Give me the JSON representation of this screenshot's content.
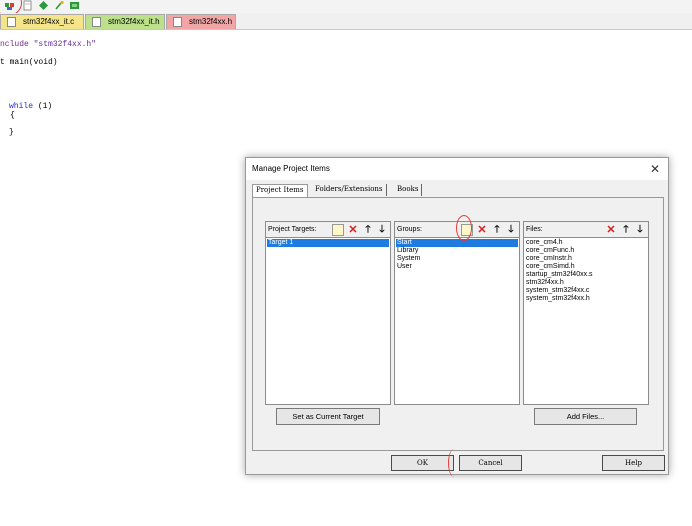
{
  "tabs": [
    {
      "label": "stm32f4xx_it.c"
    },
    {
      "label": "stm32f4xx_it.h"
    },
    {
      "label": "stm32f4xx.h"
    }
  ],
  "code": {
    "include_kw": "nclude",
    "include_file": "\"stm32f4xx.h\"",
    "main_line": "t main(void)",
    "while_kw": "while",
    "while_cond": " (1)",
    "open_brace": "{",
    "close_brace": "}"
  },
  "dialog": {
    "title": "Manage Project Items",
    "close_glyph": "✕",
    "tabs": [
      "Project Items",
      "Folders/Extensions",
      "Books"
    ],
    "targets": {
      "label": "Project Targets:",
      "items": [
        "Target 1"
      ],
      "selected": 0
    },
    "groups": {
      "label": "Groups:",
      "items": [
        "Start",
        "Library",
        "System",
        "User"
      ],
      "selected": 0
    },
    "files": {
      "label": "Files:",
      "items": [
        "core_cm4.h",
        "core_cmFunc.h",
        "core_cmInstr.h",
        "core_cmSimd.h",
        "startup_stm32f40xx.s",
        "stm32f4xx.h",
        "system_stm32f4xx.c",
        "system_stm32f4xx.h"
      ]
    },
    "icons": {
      "new": "new-item-icon",
      "delete": "delete-icon",
      "up": "move-up-icon",
      "down": "move-down-icon"
    },
    "set_target_label": "Set as Current Target",
    "add_files_label": "Add Files...",
    "ok_label": "OK",
    "cancel_label": "Cancel",
    "help_label": "Help"
  },
  "colors": {
    "selection": "#1e7be0",
    "annotation": "#e23b3b",
    "delete": "#d81e1e"
  }
}
